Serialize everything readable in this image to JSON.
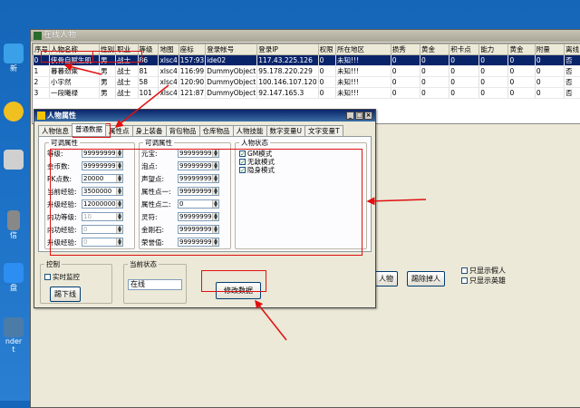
{
  "desktop": {
    "icons": [
      {
        "label": "新"
      },
      {
        "label": ""
      },
      {
        "label": ""
      },
      {
        "label": "信"
      },
      {
        "label": "盘"
      },
      {
        "label": "nder\nt"
      }
    ]
  },
  "main_window": {
    "title": "在线人物",
    "columns": [
      "序号",
      "人物名称",
      "性别",
      "职业",
      "等级",
      "地图",
      "座标",
      "登录帐号",
      "登录IP",
      "权限",
      "所在地区",
      "损秀",
      "黄金",
      "积卡点",
      "能力",
      "黄金",
      "附量",
      "离线"
    ],
    "rows": [
      {
        "cells": [
          "0",
          "侠骨自赋生肌",
          "男",
          "战士",
          "86",
          "xlsc4",
          "157:93",
          "ide02",
          "117.43.225.126",
          "0",
          "未知!!!",
          "0",
          "0",
          "0",
          "0",
          "0",
          "0",
          "否"
        ],
        "selected": true
      },
      {
        "cells": [
          "1",
          "暮暮劲乘",
          "男",
          "战士",
          "81",
          "xlsc4",
          "116:99",
          "DummyObject",
          "95.178.220.229",
          "0",
          "未知!!!",
          "0",
          "0",
          "0",
          "0",
          "0",
          "0",
          "否"
        ]
      },
      {
        "cells": [
          "2",
          "小宇然",
          "男",
          "战士",
          "58",
          "xlsc4",
          "120:90",
          "DummyObject",
          "100.146.107.120",
          "0",
          "未知!!!",
          "0",
          "0",
          "0",
          "0",
          "0",
          "0",
          "否"
        ]
      },
      {
        "cells": [
          "3",
          "一段曦禄",
          "男",
          "战士",
          "101",
          "xlsc4",
          "121:87",
          "DummyObject",
          "92.147.165.3",
          "0",
          "未知!!!",
          "0",
          "0",
          "0",
          "0",
          "0",
          "0",
          "否"
        ]
      }
    ],
    "controls": {
      "btn_person": "人物",
      "btn_kick": "踢除掉人",
      "chk_only_fake": "只显示假人",
      "chk_only_hero": "只显示英雄"
    }
  },
  "dialog": {
    "title": "人物属性",
    "tabs": [
      "人物信息",
      "普通数据",
      "属性点",
      "身上装备",
      "背包物品",
      "仓库物品",
      "人物技能",
      "数字变量U",
      "文字变量T"
    ],
    "active_tab_index": 1,
    "group_left": {
      "title": "可调属性",
      "fields": [
        {
          "label": "等级:",
          "value": "99999999"
        },
        {
          "label": "金币数:",
          "value": "99999999"
        },
        {
          "label": "PK点数:",
          "value": "20000"
        },
        {
          "label": "当前经验:",
          "value": "3500000"
        },
        {
          "label": "升级经验:",
          "value": "12000000"
        },
        {
          "label": "内功等级:",
          "value": "10",
          "disabled": true
        },
        {
          "label": "内功经验:",
          "value": "0",
          "disabled": true
        },
        {
          "label": "升级经验:",
          "value": "0",
          "disabled": true
        }
      ]
    },
    "group_mid": {
      "title": "可调属性",
      "fields": [
        {
          "label": "元宝:",
          "value": "99999999"
        },
        {
          "label": "泡点:",
          "value": "99999999"
        },
        {
          "label": "声望点:",
          "value": "99999999"
        },
        {
          "label": "属性点一:",
          "value": "99999999"
        },
        {
          "label": "属性点二:",
          "value": "0"
        },
        {
          "label": "灵符:",
          "value": "99999999"
        },
        {
          "label": "金刚石:",
          "value": "99999999"
        },
        {
          "label": "荣誉值:",
          "value": "99999999"
        }
      ]
    },
    "group_status": {
      "title": "人物状态",
      "checks": [
        {
          "label": "GM模式",
          "checked": true
        },
        {
          "label": "无敌模式",
          "checked": true
        },
        {
          "label": "隐身模式",
          "checked": true
        }
      ]
    },
    "control": {
      "title": "控制",
      "realtime_label": "实时监控",
      "kick_button": "踢下线"
    },
    "current_state": {
      "title": "当前状态",
      "value": "在线"
    },
    "modify_button": "修改数据"
  },
  "colors": {
    "highlight": "#e01010",
    "selection": "#0a246a",
    "desktop": "#1a6fc4"
  }
}
